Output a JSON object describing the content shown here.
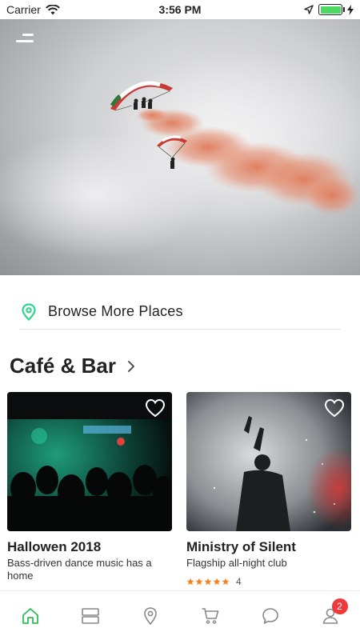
{
  "status_bar": {
    "carrier": "Carrier",
    "time": "3:56 PM",
    "battery_level": 1.0
  },
  "browse": {
    "label": "Browse More Places"
  },
  "section": {
    "title": "Café & Bar"
  },
  "cards": [
    {
      "title": "Hallowen 2018",
      "description": "Bass-driven dance music has a home"
    },
    {
      "title": "Ministry of Silent",
      "description": "Flagship all-night club",
      "rating": 5,
      "rating_count": "4"
    }
  ],
  "tab_bar": {
    "cart_badge": "2",
    "active_tab": "home"
  },
  "colors": {
    "accent": "#2ebd59",
    "pin": "#2fd58a",
    "star": "#f5821f",
    "badge": "#f0393b"
  },
  "icons": [
    "menu-icon",
    "location-pin-icon",
    "chevron-right-icon",
    "heart-icon",
    "home-icon",
    "list-icon",
    "map-pin-icon",
    "cart-icon",
    "chat-icon",
    "profile-icon",
    "wifi-icon",
    "location-arrow-icon",
    "battery-icon",
    "charging-icon"
  ]
}
